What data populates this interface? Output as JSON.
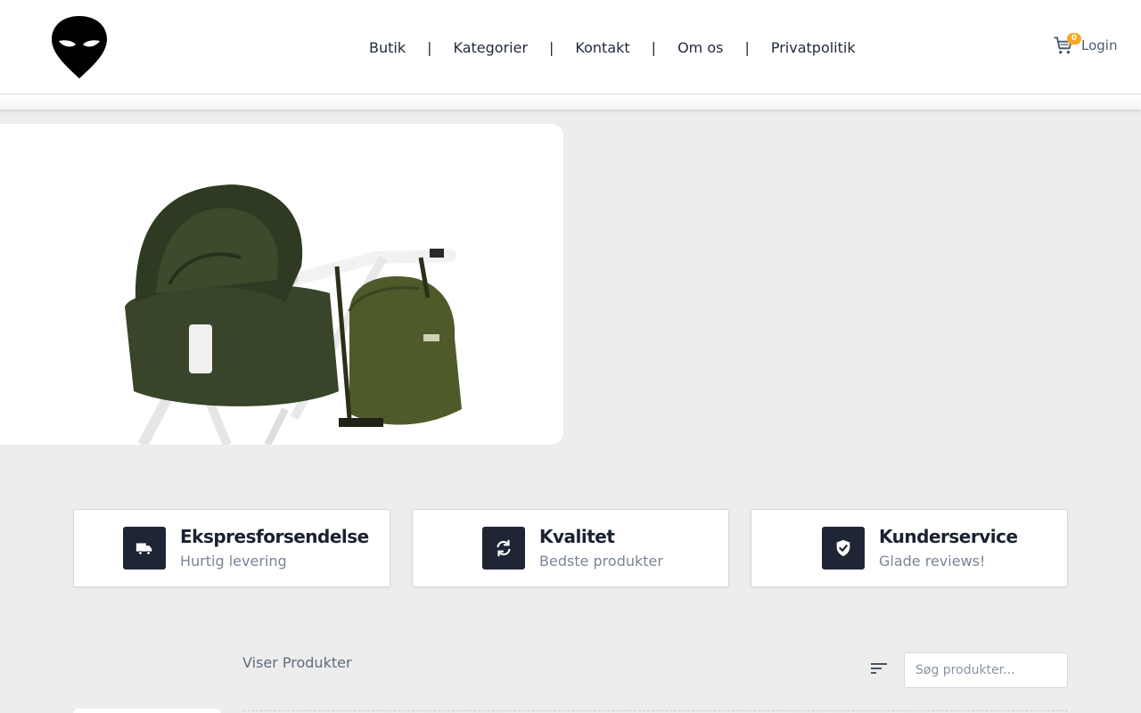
{
  "header": {
    "nav": [
      "Butik",
      "Kategorier",
      "Kontakt",
      "Om os",
      "Privatpolitik"
    ],
    "separator": "|",
    "cart_count": "0",
    "login_label": "Login"
  },
  "features": [
    {
      "title": "Ekspresforsendelse",
      "subtitle": "Hurtig levering",
      "icon": "truck-icon"
    },
    {
      "title": "Kvalitet",
      "subtitle": "Bedste produkter",
      "icon": "refresh-icon"
    },
    {
      "title": "Kunderservice",
      "subtitle": "Glade reviews!",
      "icon": "shield-check-icon"
    }
  ],
  "products": {
    "heading": "Viser Produkter",
    "search_placeholder": "Søg produkter..."
  },
  "colors": {
    "accent_dark": "#1e2535",
    "badge": "#f5a623",
    "page_bg": "#ededed"
  }
}
